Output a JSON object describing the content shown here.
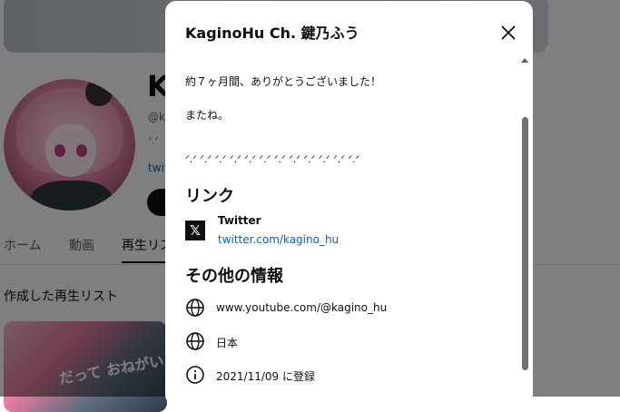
{
  "background": {
    "channel_name_partial": "K",
    "handle_partial": "@ka",
    "description_partial": "ᐟ.ᐟ",
    "link_partial": "twit",
    "tabs": [
      "ホーム",
      "動画",
      "再生リス"
    ],
    "section_title": "作成した再生リスト",
    "thumbnail_text": "だって おねがい"
  },
  "dialog": {
    "title": "KaginoHu Ch. 鍵乃ふう",
    "description_lines": [
      "約７ヶ月間、ありがとうございました！",
      "またね。"
    ],
    "decoration": "ᐟ.ᐟ ᐟ.ᐟ ᐟ.ᐟ ᐟ.ᐟ ᐟ.ᐟ ᐟ.ᐟ ᐟ.ᐟ ᐟ.ᐟ ᐟ.ᐟ ᐟ.ᐟ ᐟ.ᐟ ᐟ.ᐟ",
    "links_heading": "リンク",
    "links": [
      {
        "name": "Twitter",
        "url": "twitter.com/kagino_hu",
        "icon": "x-logo-icon"
      }
    ],
    "other_heading": "その他の情報",
    "other_info": [
      {
        "icon": "globe-icon",
        "text": "www.youtube.com/@kagino_hu"
      },
      {
        "icon": "globe-icon",
        "text": "日本"
      },
      {
        "icon": "info-icon",
        "text": "2021/11/09 に登録"
      }
    ]
  },
  "colors": {
    "link": "#065fd4",
    "overlay": "rgba(0,0,0,0.5)",
    "scrollbar": "#717171"
  }
}
